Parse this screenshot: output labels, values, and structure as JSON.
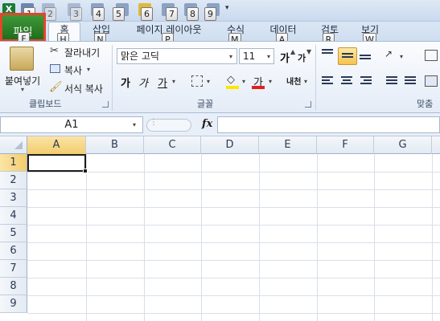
{
  "qat": {
    "keytips": [
      "1",
      "2",
      "3",
      "4",
      "5",
      "6",
      "7",
      "8",
      "9"
    ]
  },
  "tabs": {
    "file": {
      "label": "파일",
      "keytip": "F"
    },
    "home": {
      "label": "홈",
      "keytip": "H"
    },
    "insert": {
      "label": "삽입",
      "keytip": "N"
    },
    "page_layout": {
      "label": "페이지 레이아웃",
      "keytip": "P"
    },
    "formulas": {
      "label": "수식",
      "keytip": "M"
    },
    "data": {
      "label": "데이터",
      "keytip": "A"
    },
    "review": {
      "label": "검토",
      "keytip": "R"
    },
    "view": {
      "label": "보기",
      "keytip": "W"
    }
  },
  "ribbon": {
    "clipboard": {
      "paste": "붙여넣기",
      "cut": "잘라내기",
      "copy": "복사",
      "format_painter": "서식 복사",
      "group_label": "클립보드"
    },
    "font": {
      "font_name": "맑은 고딕",
      "font_size": "11",
      "bold": "가",
      "italic": "가",
      "underline": "가",
      "grow": "가",
      "shrink": "가",
      "font_color_glyph": "가",
      "phonetic": "내천",
      "group_label": "글꼴"
    },
    "alignment": {
      "group_label": "맞춤"
    }
  },
  "formula_bar": {
    "name_box": "A1",
    "fx": "fx",
    "formula": ""
  },
  "grid": {
    "columns": [
      "A",
      "B",
      "C",
      "D",
      "E",
      "F",
      "G"
    ],
    "rows": [
      "1",
      "2",
      "3",
      "4",
      "5",
      "6",
      "7",
      "8",
      "9"
    ]
  },
  "colors": {
    "file_tab": "#2b7f27",
    "highlight_border": "#e2462b",
    "active_col_header": "#f6d27a"
  }
}
